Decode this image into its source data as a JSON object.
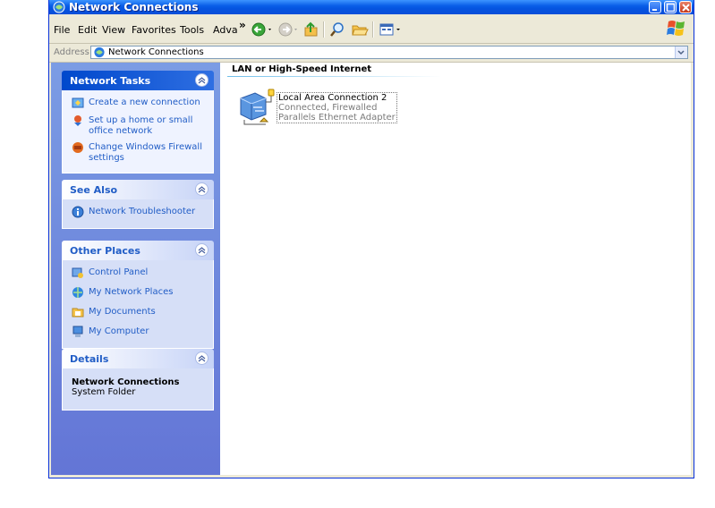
{
  "window": {
    "title": "Network Connections"
  },
  "menubar": {
    "items": [
      "File",
      "Edit",
      "View",
      "Favorites",
      "Tools",
      "Adva"
    ],
    "overflow": "»"
  },
  "addressbar": {
    "label": "Address",
    "value": "Network Connections"
  },
  "taskpane": {
    "network_tasks": {
      "title": "Network Tasks",
      "items": [
        {
          "label": "Create a new connection",
          "icon": "new-connection-icon"
        },
        {
          "label": "Set up a home or small office network",
          "icon": "home-network-icon"
        },
        {
          "label": "Change Windows Firewall settings",
          "icon": "firewall-icon"
        }
      ]
    },
    "see_also": {
      "title": "See Also",
      "items": [
        {
          "label": "Network Troubleshooter",
          "icon": "troubleshooter-icon"
        }
      ]
    },
    "other_places": {
      "title": "Other Places",
      "items": [
        {
          "label": "Control Panel",
          "icon": "control-panel-icon"
        },
        {
          "label": "My Network Places",
          "icon": "network-places-icon"
        },
        {
          "label": "My Documents",
          "icon": "my-documents-icon"
        },
        {
          "label": "My Computer",
          "icon": "my-computer-icon"
        }
      ]
    },
    "details": {
      "title": "Details",
      "name": "Network Connections",
      "type": "System Folder"
    }
  },
  "main": {
    "section_title": "LAN or High-Speed Internet",
    "connection": {
      "name": "Local Area Connection 2",
      "status": "Connected, Firewalled",
      "device": "Parallels Ethernet Adapter",
      "icon": "lan-connection-icon"
    }
  },
  "colors": {
    "titlebar": "#0554e0",
    "taskpane": "#6375d6",
    "link": "#215dc6",
    "close_button": "#c4381a"
  }
}
